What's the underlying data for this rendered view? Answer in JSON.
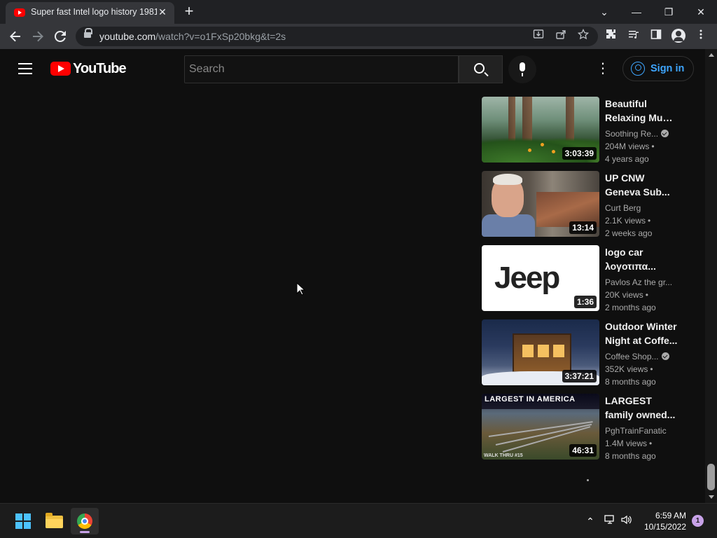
{
  "browser": {
    "tab_title": "Super fast Intel logo history 1981",
    "tab_close": "✕",
    "new_tab": "+",
    "url_host": "youtube.com",
    "url_path": "/watch?v=o1FxSp20bkg&t=2s",
    "window_controls": {
      "tab_search": "⌄",
      "minimize": "—",
      "restore": "❐",
      "close": "✕"
    }
  },
  "youtube": {
    "logo_text": "YouTube",
    "search_placeholder": "Search",
    "more_icon": "⋮",
    "sign_in_label": "Sign in"
  },
  "recommendations": [
    {
      "title_line1": "Beautiful",
      "title_line2": "Relaxing Musi...",
      "channel": "Soothing Re...",
      "verified": true,
      "views": "204M views",
      "age": "4 years ago",
      "duration": "3:03:39",
      "thumb": "forest"
    },
    {
      "title_line1": "UP CNW",
      "title_line2": "Geneva Sub...",
      "channel": "Curt Berg",
      "verified": false,
      "views": "2.1K views",
      "age": "2 weeks ago",
      "duration": "13:14",
      "thumb": "man"
    },
    {
      "title_line1": "logo car",
      "title_line2": "λογοτιπα...",
      "channel": "Pavlos Az the gr...",
      "verified": false,
      "views": "20K views",
      "age": "2 months ago",
      "duration": "1:36",
      "thumb": "jeep",
      "thumb_text": "Jeep"
    },
    {
      "title_line1": "Outdoor Winter",
      "title_line2": "Night at Coffe...",
      "channel": "Coffee Shop...",
      "verified": true,
      "views": "352K views",
      "age": "8 months ago",
      "duration": "3:37:21",
      "thumb": "coffee"
    },
    {
      "title_line1": "LARGEST",
      "title_line2": "family owned...",
      "channel": "PghTrainFanatic",
      "verified": false,
      "views": "1.4M views",
      "age": "8 months ago",
      "duration": "46:31",
      "thumb": "train",
      "thumb_text": "LARGEST IN AMERICA",
      "thumb_subtext": "WALK THRU #15"
    }
  ],
  "taskbar": {
    "time": "6:59 AM",
    "date": "10/15/2022",
    "notification_count": "1",
    "tray_chevron": "⌃",
    "tray_network": "🖵",
    "tray_volume": "🔊"
  },
  "colors": {
    "background": "#0f0f0f",
    "accent_blue": "#3ea6ff",
    "youtube_red": "#ff0000"
  }
}
